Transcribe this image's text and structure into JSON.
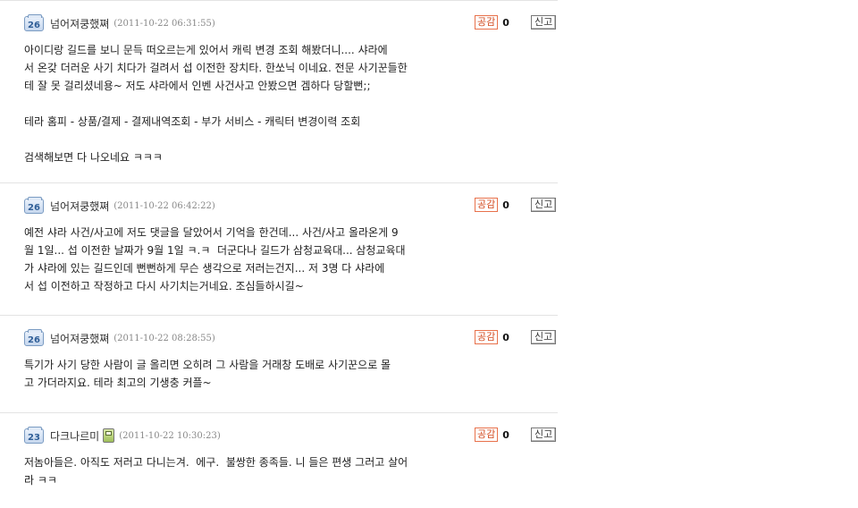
{
  "comments": [
    {
      "level": "26",
      "nick": "넘어져쿵했쪄",
      "date": "(2011-10-22 06:31:55)",
      "gg_label": "공감",
      "gg_count": "0",
      "report_label": "신고",
      "lines": [
        "아이디랑 길드를 보니 문득 떠오르는게 있어서 캐릭 변경 조회 해봤더니.... 샤라에",
        "서 온갖 더러운 사기 치다가 걸려서 섭 이전한 장치타. 한쏘닉 이네요. 전문 사기꾼들한",
        "테 잘 못 걸리셨네용~ 저도 샤라에서 인벤 사건사고 안봤으면 겜하다 당할뻔;;",
        "",
        "테라 홈피 - 상품/결제 - 결제내역조회 - 부가 서비스 - 캐릭터 변경이력 조회",
        "",
        "검색해보면 다 나오네요 ㅋㅋㅋ"
      ]
    },
    {
      "level": "26",
      "nick": "넘어져쿵했쪄",
      "date": "(2011-10-22 06:42:22)",
      "gg_label": "공감",
      "gg_count": "0",
      "report_label": "신고",
      "lines": [
        "예전 샤라 사건/사고에 저도 댓글을 달았어서 기억을 한건데... 사건/사고 올라온게 9",
        "월 1일... 섭 이전한 날짜가 9월 1일 ㅋ.ㅋ  더군다나 길드가 삼청교육대... 삼청교육대",
        "가 샤라에 있는 길드인데 뻔뻔하게 무슨 생각으로 저러는건지... 저 3명 다 샤라에",
        "서 섭 이전하고 작정하고 다시 사기치는거네요. 조심들하시길~"
      ]
    },
    {
      "level": "26",
      "nick": "넘어져쿵했쪄",
      "date": "(2011-10-22 08:28:55)",
      "gg_label": "공감",
      "gg_count": "0",
      "report_label": "신고",
      "lines": [
        "특기가 사기 당한 사람이 글 올리면 오히려 그 사람을 거래창 도배로 사기꾼으로 몰",
        "고 가더라지요. 테라 최고의 기생충 커플~"
      ]
    },
    {
      "level": "23",
      "nick": "다크나르미",
      "has_phone_icon": true,
      "date": "(2011-10-22 10:30:23)",
      "gg_label": "공감",
      "gg_count": "0",
      "report_label": "신고",
      "lines": [
        "저놈아들은. 아직도 저러고 다니는겨.  에구.  불쌍한 종족들. 니 들은 편생 그러고 살어",
        "라 ㅋㅋ"
      ]
    }
  ],
  "colors": {
    "gg_border": "#e8714b",
    "gg_text": "#d2481d",
    "level_badge": "#7a9bc2"
  },
  "icons": {
    "level": "level-badge-icon",
    "mobile": "mobile-phone-icon"
  }
}
